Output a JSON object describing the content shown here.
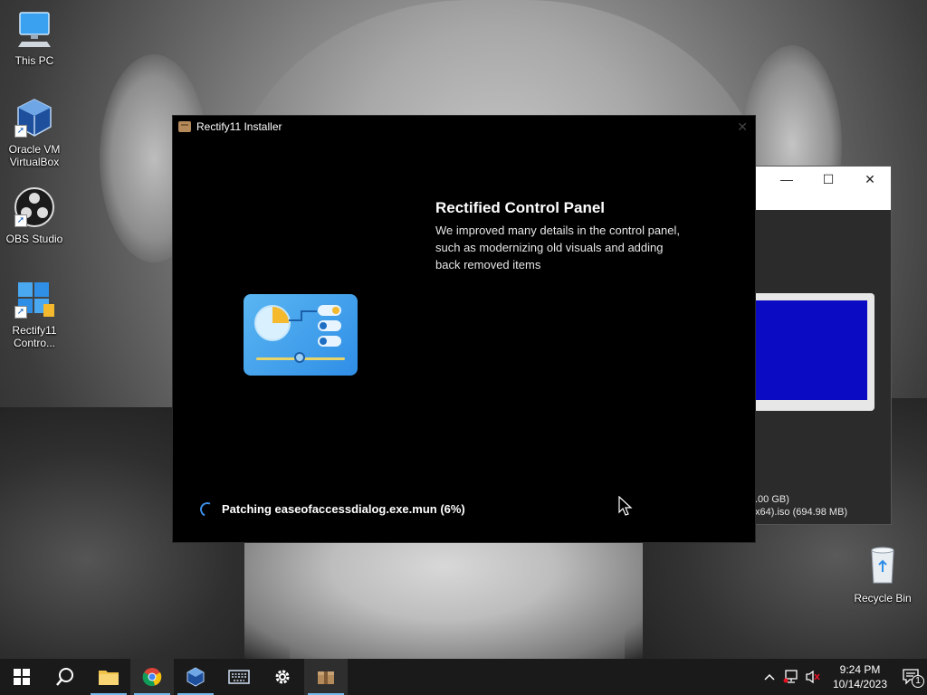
{
  "desktop": {
    "icons": [
      {
        "label": "This PC"
      },
      {
        "label": "Oracle VM VirtualBox"
      },
      {
        "label": "OBS Studio"
      },
      {
        "label": "Rectify11 Contro..."
      }
    ],
    "recycle_bin": {
      "label": "Recycle Bin"
    }
  },
  "background_window": {
    "minimize_label": "—",
    "maximize_label": "☐",
    "close_label": "✕",
    "info_line1": ".00 GB)",
    "info_line2": "x64).iso (694.98 MB)"
  },
  "installer": {
    "title": "Rectify11 Installer",
    "close_label": "✕",
    "feature_title": "Rectified Control Panel",
    "feature_description": "We improved many details in the control panel, such as modernizing old visuals and adding back removed items",
    "status_text": "Patching easeofaccessdialog.exe.mun (6%)",
    "progress_percent": 6
  },
  "taskbar": {
    "items": [
      {
        "icon": "windows-start-icon"
      },
      {
        "icon": "search-icon"
      },
      {
        "icon": "file-explorer-icon"
      },
      {
        "icon": "chrome-icon"
      },
      {
        "icon": "virtualbox-icon"
      },
      {
        "icon": "on-screen-keyboard-icon"
      },
      {
        "icon": "settings-gear-icon"
      },
      {
        "icon": "rectify11-installer-icon"
      }
    ],
    "clock_time": "9:24 PM",
    "clock_date": "10/14/2023",
    "notification_count": "1",
    "tray_chevron": "^"
  }
}
